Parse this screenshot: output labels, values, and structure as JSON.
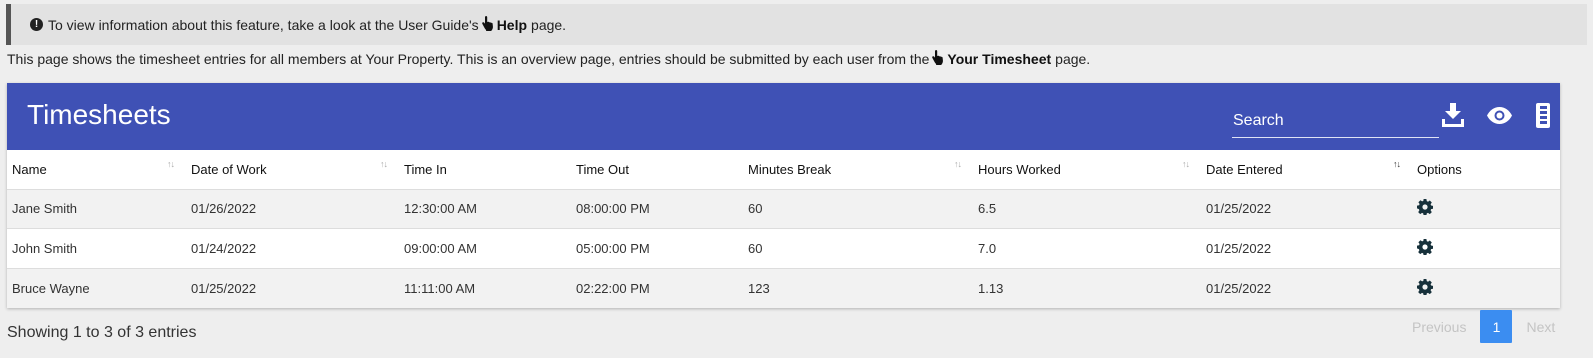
{
  "alert": {
    "icon": "exclamation-circle-icon",
    "text_before": "To view information about this feature, take a look at the User Guide's",
    "link_label": "Help",
    "text_after": "page."
  },
  "intro": {
    "text_before": "This page shows the timesheet entries for all members at Your Property. This is an overview page, entries should be submitted by each user from the",
    "link_label": "Your Timesheet",
    "text_after": "page."
  },
  "card": {
    "title": "Timesheets",
    "header_color": "#3f51b5",
    "search_placeholder": "Search",
    "icons": [
      "download-icon",
      "eye-icon",
      "columns-icon"
    ]
  },
  "table": {
    "columns": [
      "Name",
      "Date of Work",
      "Time In",
      "Time Out",
      "Minutes Break",
      "Hours Worked",
      "Date Entered",
      "Options"
    ],
    "rows": [
      {
        "name": "Jane Smith",
        "date_of_work": "01/26/2022",
        "time_in": "12:30:00 AM",
        "time_out": "08:00:00 PM",
        "minutes_break": "60",
        "hours_worked": "6.5",
        "date_entered": "01/25/2022"
      },
      {
        "name": "John Smith",
        "date_of_work": "01/24/2022",
        "time_in": "09:00:00 AM",
        "time_out": "05:00:00 PM",
        "minutes_break": "60",
        "hours_worked": "7.0",
        "date_entered": "01/25/2022"
      },
      {
        "name": "Bruce Wayne",
        "date_of_work": "01/25/2022",
        "time_in": "11:11:00 AM",
        "time_out": "02:22:00 PM",
        "minutes_break": "123",
        "hours_worked": "1.13",
        "date_entered": "01/25/2022"
      }
    ],
    "option_icon": "gear-icon"
  },
  "footer": {
    "info": "Showing 1 to 3 of 3 entries",
    "previous": "Previous",
    "page": "1",
    "next": "Next",
    "active_page_color": "#3b8df1"
  }
}
